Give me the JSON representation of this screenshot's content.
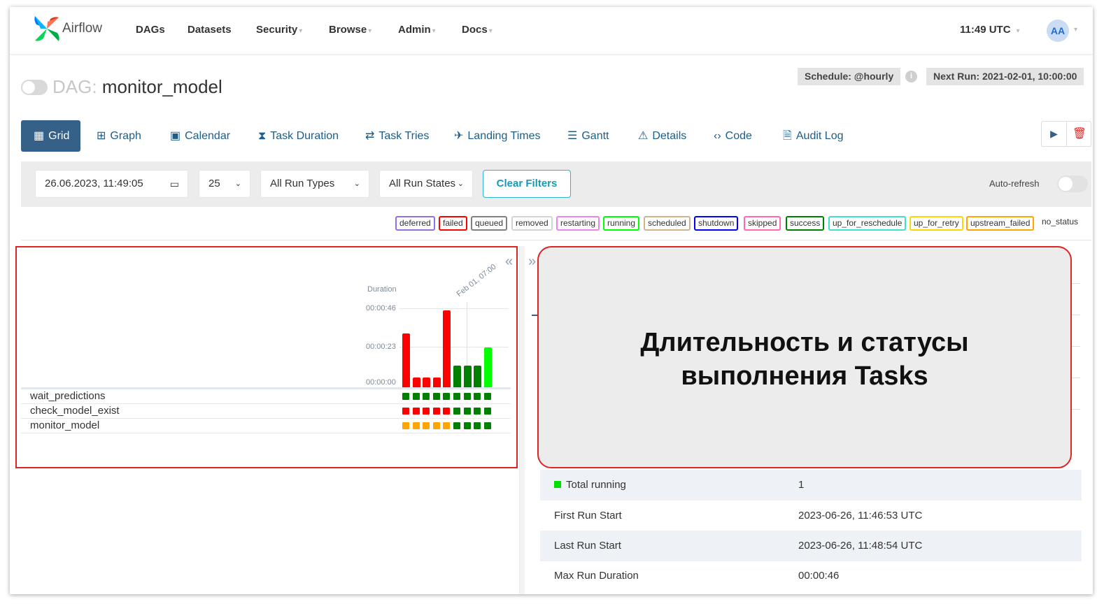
{
  "navbar": {
    "brand": "Airflow",
    "items": [
      {
        "label": "DAGs",
        "caret": false
      },
      {
        "label": "Datasets",
        "caret": false
      },
      {
        "label": "Security",
        "caret": true
      },
      {
        "label": "Browse",
        "caret": true
      },
      {
        "label": "Admin",
        "caret": true
      },
      {
        "label": "Docs",
        "caret": true
      }
    ],
    "clock": "11:49 UTC",
    "avatar": "AA"
  },
  "dag": {
    "prefix": "DAG:",
    "name": "monitor_model",
    "schedule": "Schedule: @hourly",
    "next_run": "Next Run: 2021-02-01, 10:00:00"
  },
  "tabs": [
    {
      "label": "Grid",
      "icon": "grid-icon",
      "active": true
    },
    {
      "label": "Graph",
      "icon": "graph-icon"
    },
    {
      "label": "Calendar",
      "icon": "calendar-icon"
    },
    {
      "label": "Task Duration",
      "icon": "hourglass-icon"
    },
    {
      "label": "Task Tries",
      "icon": "retry-icon"
    },
    {
      "label": "Landing Times",
      "icon": "landing-icon"
    },
    {
      "label": "Gantt",
      "icon": "gantt-icon"
    },
    {
      "label": "Details",
      "icon": "warning-icon"
    },
    {
      "label": "Code",
      "icon": "code-icon"
    },
    {
      "label": "Audit Log",
      "icon": "file-search-icon"
    }
  ],
  "filters": {
    "date": "26.06.2023, 11:49:05",
    "num_runs": "25",
    "run_types": "All Run Types",
    "run_states": "All Run States",
    "clear": "Clear Filters",
    "auto_refresh": "Auto-refresh"
  },
  "legend": [
    {
      "label": "deferred",
      "color": "#9370db"
    },
    {
      "label": "failed",
      "color": "#ff0000"
    },
    {
      "label": "queued",
      "color": "#808080"
    },
    {
      "label": "removed",
      "color": "#d3d3d3"
    },
    {
      "label": "restarting",
      "color": "#ee82ee"
    },
    {
      "label": "running",
      "color": "#00ff00"
    },
    {
      "label": "scheduled",
      "color": "#d2b48c"
    },
    {
      "label": "shutdown",
      "color": "#0000ff"
    },
    {
      "label": "skipped",
      "color": "#ff69b4"
    },
    {
      "label": "success",
      "color": "#008000"
    },
    {
      "label": "up_for_reschedule",
      "color": "#40e0d0"
    },
    {
      "label": "up_for_retry",
      "color": "#ffd700"
    },
    {
      "label": "upstream_failed",
      "color": "#ffa500"
    },
    {
      "label": "no_status",
      "color": ""
    }
  ],
  "grid": {
    "duration_label": "Duration",
    "ticks": [
      "00:00:46",
      "00:00:23",
      "00:00:00"
    ],
    "date_label": "Feb 01, 07:00",
    "collapse_icon": "«",
    "expand_icon": "»",
    "run_durations_sec": [
      32,
      6,
      6,
      6,
      46,
      13,
      13,
      13,
      24
    ],
    "run_colors": [
      "#ff0000",
      "#ff0000",
      "#ff0000",
      "#ff0000",
      "#ff0000",
      "#008000",
      "#008000",
      "#008000",
      "#00ff00"
    ],
    "tasks": [
      {
        "name": "wait_predictions",
        "states": [
          "#008000",
          "#008000",
          "#008000",
          "#008000",
          "#008000",
          "#008000",
          "#008000",
          "#008000",
          "#008000"
        ]
      },
      {
        "name": "check_model_exist",
        "states": [
          "#ff0000",
          "#ff0000",
          "#ff0000",
          "#ff0000",
          "#ff0000",
          "#008000",
          "#008000",
          "#008000",
          "#008000"
        ]
      },
      {
        "name": "monitor_model",
        "states": [
          "#ffa500",
          "#ffa500",
          "#ffa500",
          "#ffa500",
          "#ffa500",
          "#008000",
          "#008000",
          "#008000",
          "#008000"
        ]
      }
    ]
  },
  "annotation": {
    "line1": "Длительность и статусы",
    "line2": "выполнения Tasks"
  },
  "details": [
    {
      "key": "Total running",
      "value": "1",
      "marker": "#00e000"
    },
    {
      "key": "First Run Start",
      "value": "2023-06-26, 11:46:53 UTC"
    },
    {
      "key": "Last Run Start",
      "value": "2023-06-26, 11:48:54 UTC"
    },
    {
      "key": "Max Run Duration",
      "value": "00:00:46"
    }
  ]
}
